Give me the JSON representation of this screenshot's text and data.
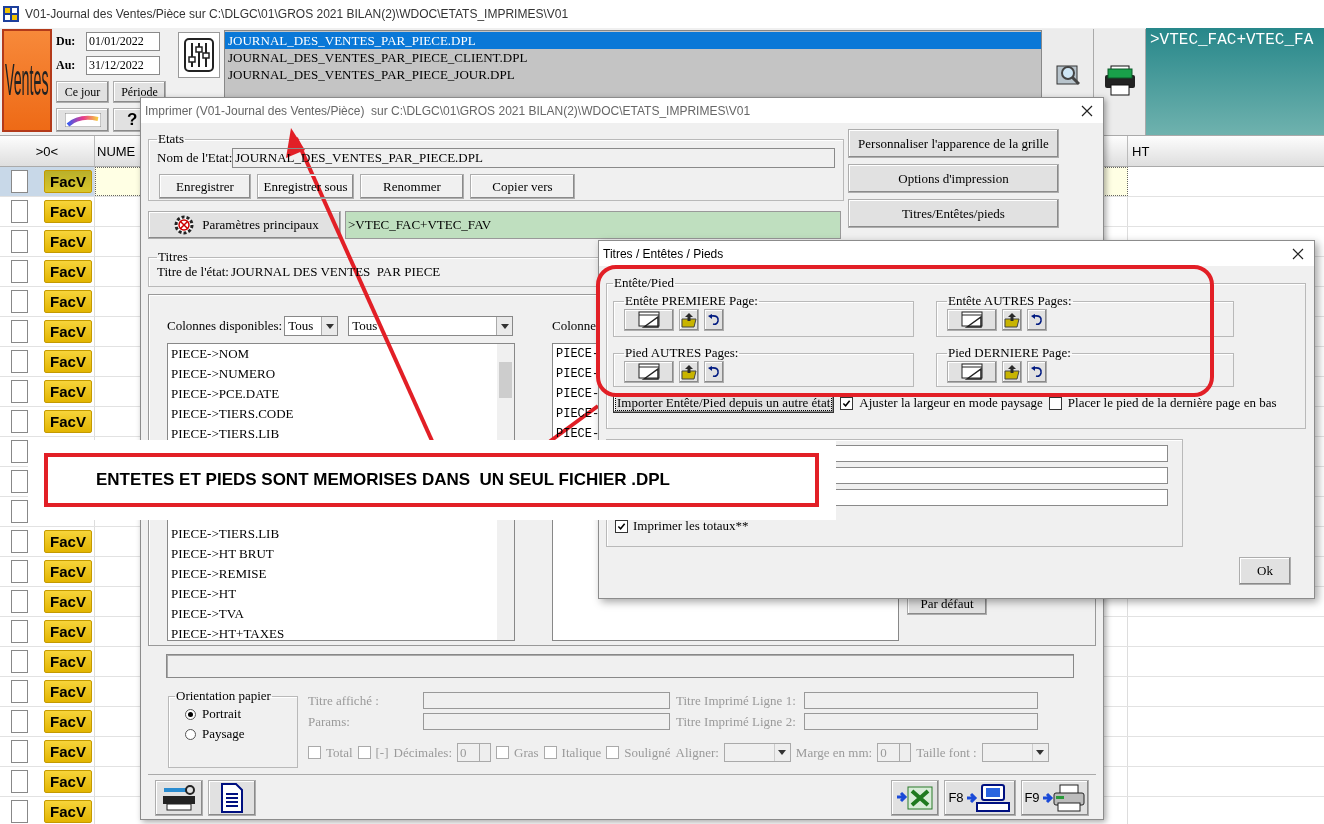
{
  "window": {
    "title": "V01-Journal des Ventes/Pièce sur C:\\DLGC\\01\\GROS 2021 BILAN(2)\\WDOC\\ETATS_IMPRIMES\\V01"
  },
  "toolbar": {
    "module": "Ventes",
    "period": [
      {
        "label": "Du:",
        "value": "01/01/2022"
      },
      {
        "label": "Au:",
        "value": "31/12/2022"
      }
    ],
    "buttons": [
      "Ce jour",
      "Période"
    ],
    "help": "?",
    "files": [
      {
        "name": "JOURNAL_DES_VENTES_PAR_PIECE.DPL",
        "selected": true
      },
      {
        "name": "JOURNAL_DES_VENTES_PAR_PIECE_CLIENT.DPL",
        "selected": false
      },
      {
        "name": "JOURNAL_DES_VENTES_PAR_PIECE_JOUR.DPL",
        "selected": false
      }
    ],
    "filter": ">VTEC_FAC+VTEC_FA"
  },
  "grid": {
    "columns": [
      ">0<",
      "NUME",
      "HT"
    ],
    "rows": [
      {
        "badge": "FacV",
        "selected": true,
        "checked": false
      },
      {
        "badge": "FacV",
        "selected": false,
        "checked": false
      },
      {
        "badge": "FacV",
        "selected": false,
        "checked": false
      },
      {
        "badge": "FacV",
        "selected": false,
        "checked": false
      },
      {
        "badge": "FacV",
        "selected": false,
        "checked": false
      },
      {
        "badge": "FacV",
        "selected": false,
        "checked": false
      },
      {
        "badge": "FacV",
        "selected": false,
        "checked": false
      },
      {
        "badge": "FacV",
        "selected": false,
        "checked": false
      },
      {
        "badge": "FacV",
        "selected": false,
        "checked": false
      },
      {
        "selected": false,
        "checked": false
      },
      {
        "selected": false,
        "checked": false
      },
      {
        "selected": false,
        "checked": false
      },
      {
        "badge": "FacV",
        "selected": false,
        "checked": false
      },
      {
        "badge": "FacV",
        "selected": false,
        "checked": false
      },
      {
        "badge": "FacV",
        "selected": false,
        "checked": false
      },
      {
        "badge": "FacV",
        "selected": false,
        "checked": false
      },
      {
        "badge": "FacV",
        "selected": false,
        "checked": false
      },
      {
        "badge": "FacV",
        "selected": false,
        "checked": false
      },
      {
        "badge": "FacV",
        "selected": false,
        "checked": false
      },
      {
        "badge": "FacV",
        "selected": false,
        "checked": false
      },
      {
        "badge": "FacV",
        "selected": false,
        "checked": false
      },
      {
        "badge": "FacV",
        "selected": false,
        "checked": false
      }
    ]
  },
  "print_dialog": {
    "title": "Imprimer (V01-Journal des Ventes/Pièce)  sur C:\\DLGC\\01\\GROS 2021 BILAN(2)\\WDOC\\ETATS_IMPRIMES\\V01",
    "states": {
      "legend": "Etats",
      "name_label": "Nom de l'Etat:",
      "name": "JOURNAL_DES_VENTES_PAR_PIECE.DPL",
      "buttons": [
        "Enregistrer",
        "Enregistrer sous",
        "Renommer",
        "Copier vers"
      ]
    },
    "main_params": {
      "button": "Paramètres principaux",
      "filter": ">VTEC_FAC+VTEC_FAV"
    },
    "side_buttons": [
      "Personnaliser l'apparence de la grille",
      "Options d'impression",
      "Titres/Entêtes/pieds"
    ],
    "titles": {
      "legend": "Titres",
      "title_label": "Titre de l'état:",
      "title": "JOURNAL DES VENTES  PAR PIECE"
    },
    "columns": {
      "available_label": "Colonnes disponibles:",
      "filter_1": "Tous",
      "filter_2": "Tous",
      "available": [
        "PIECE->NOM",
        "PIECE->NUMERO",
        "PIECE->PCE.DATE",
        "PIECE->TIERS.CODE",
        "PIECE->TIERS.LIB",
        "PIECE->TIERS.LIB",
        "PIECE->HT BRUT",
        "PIECE->REMISE",
        "PIECE->HT",
        "PIECE->TVA",
        "PIECE->HT+TAXES"
      ],
      "chosen_label": "Colonne",
      "chosen": [
        "PIECE-",
        "PIECE-",
        "PIECE-",
        "PIECE-",
        "PIECE-"
      ],
      "default_button": "Par défaut"
    },
    "orientation": {
      "legend": "Orientation papier",
      "options": [
        {
          "label": "Portrait",
          "selected": true
        },
        {
          "label": "Paysage",
          "selected": false
        }
      ]
    },
    "format": {
      "disabled": true,
      "fields": [
        "Titre affiché :",
        "Titre Imprimé Ligne 1:",
        "Params:",
        "Titre Imprimé Ligne 2:"
      ],
      "options": [
        {
          "kind": "checkbox",
          "label": "Total",
          "checked": false
        },
        {
          "kind": "checkbox",
          "label": "[-]",
          "checked": false
        },
        {
          "kind": "spinner",
          "label": "Décimales:",
          "value": "0"
        },
        {
          "kind": "checkbox",
          "label": "Gras",
          "checked": false
        },
        {
          "kind": "checkbox",
          "label": "Italique",
          "checked": false
        },
        {
          "kind": "checkbox",
          "label": "Souligné",
          "checked": false
        },
        {
          "kind": "dropdown",
          "label": "Aligner:"
        },
        {
          "kind": "spinner",
          "label": "Marge en mm:",
          "value": "0"
        },
        {
          "kind": "dropdown",
          "label": "Taille font :"
        }
      ]
    },
    "footer_keys": [
      "F8",
      "F9"
    ]
  },
  "titles_dialog": {
    "title": "Titres / Entêtes / Pieds",
    "legend": "Entête/Pied",
    "sections": [
      "Entête PREMIERE Page:",
      "Entête AUTRES Pages:",
      "Pied AUTRES Pages:",
      "Pied DERNIERE Page:"
    ],
    "import_button": "Importer Entête/Pied depuis un autre état",
    "options": [
      {
        "label": "Ajuster la largeur en mode paysage",
        "checked": true
      },
      {
        "label": "Placer le pied de la dernière page en bas",
        "checked": false
      }
    ],
    "totals": {
      "label": "Imprimer les totaux**",
      "checked": true
    },
    "ok": "Ok"
  },
  "annotation": {
    "note": "ENTETES ET PIEDS SONT MEMORISES DANS  UN SEUL FICHIER .DPL"
  }
}
